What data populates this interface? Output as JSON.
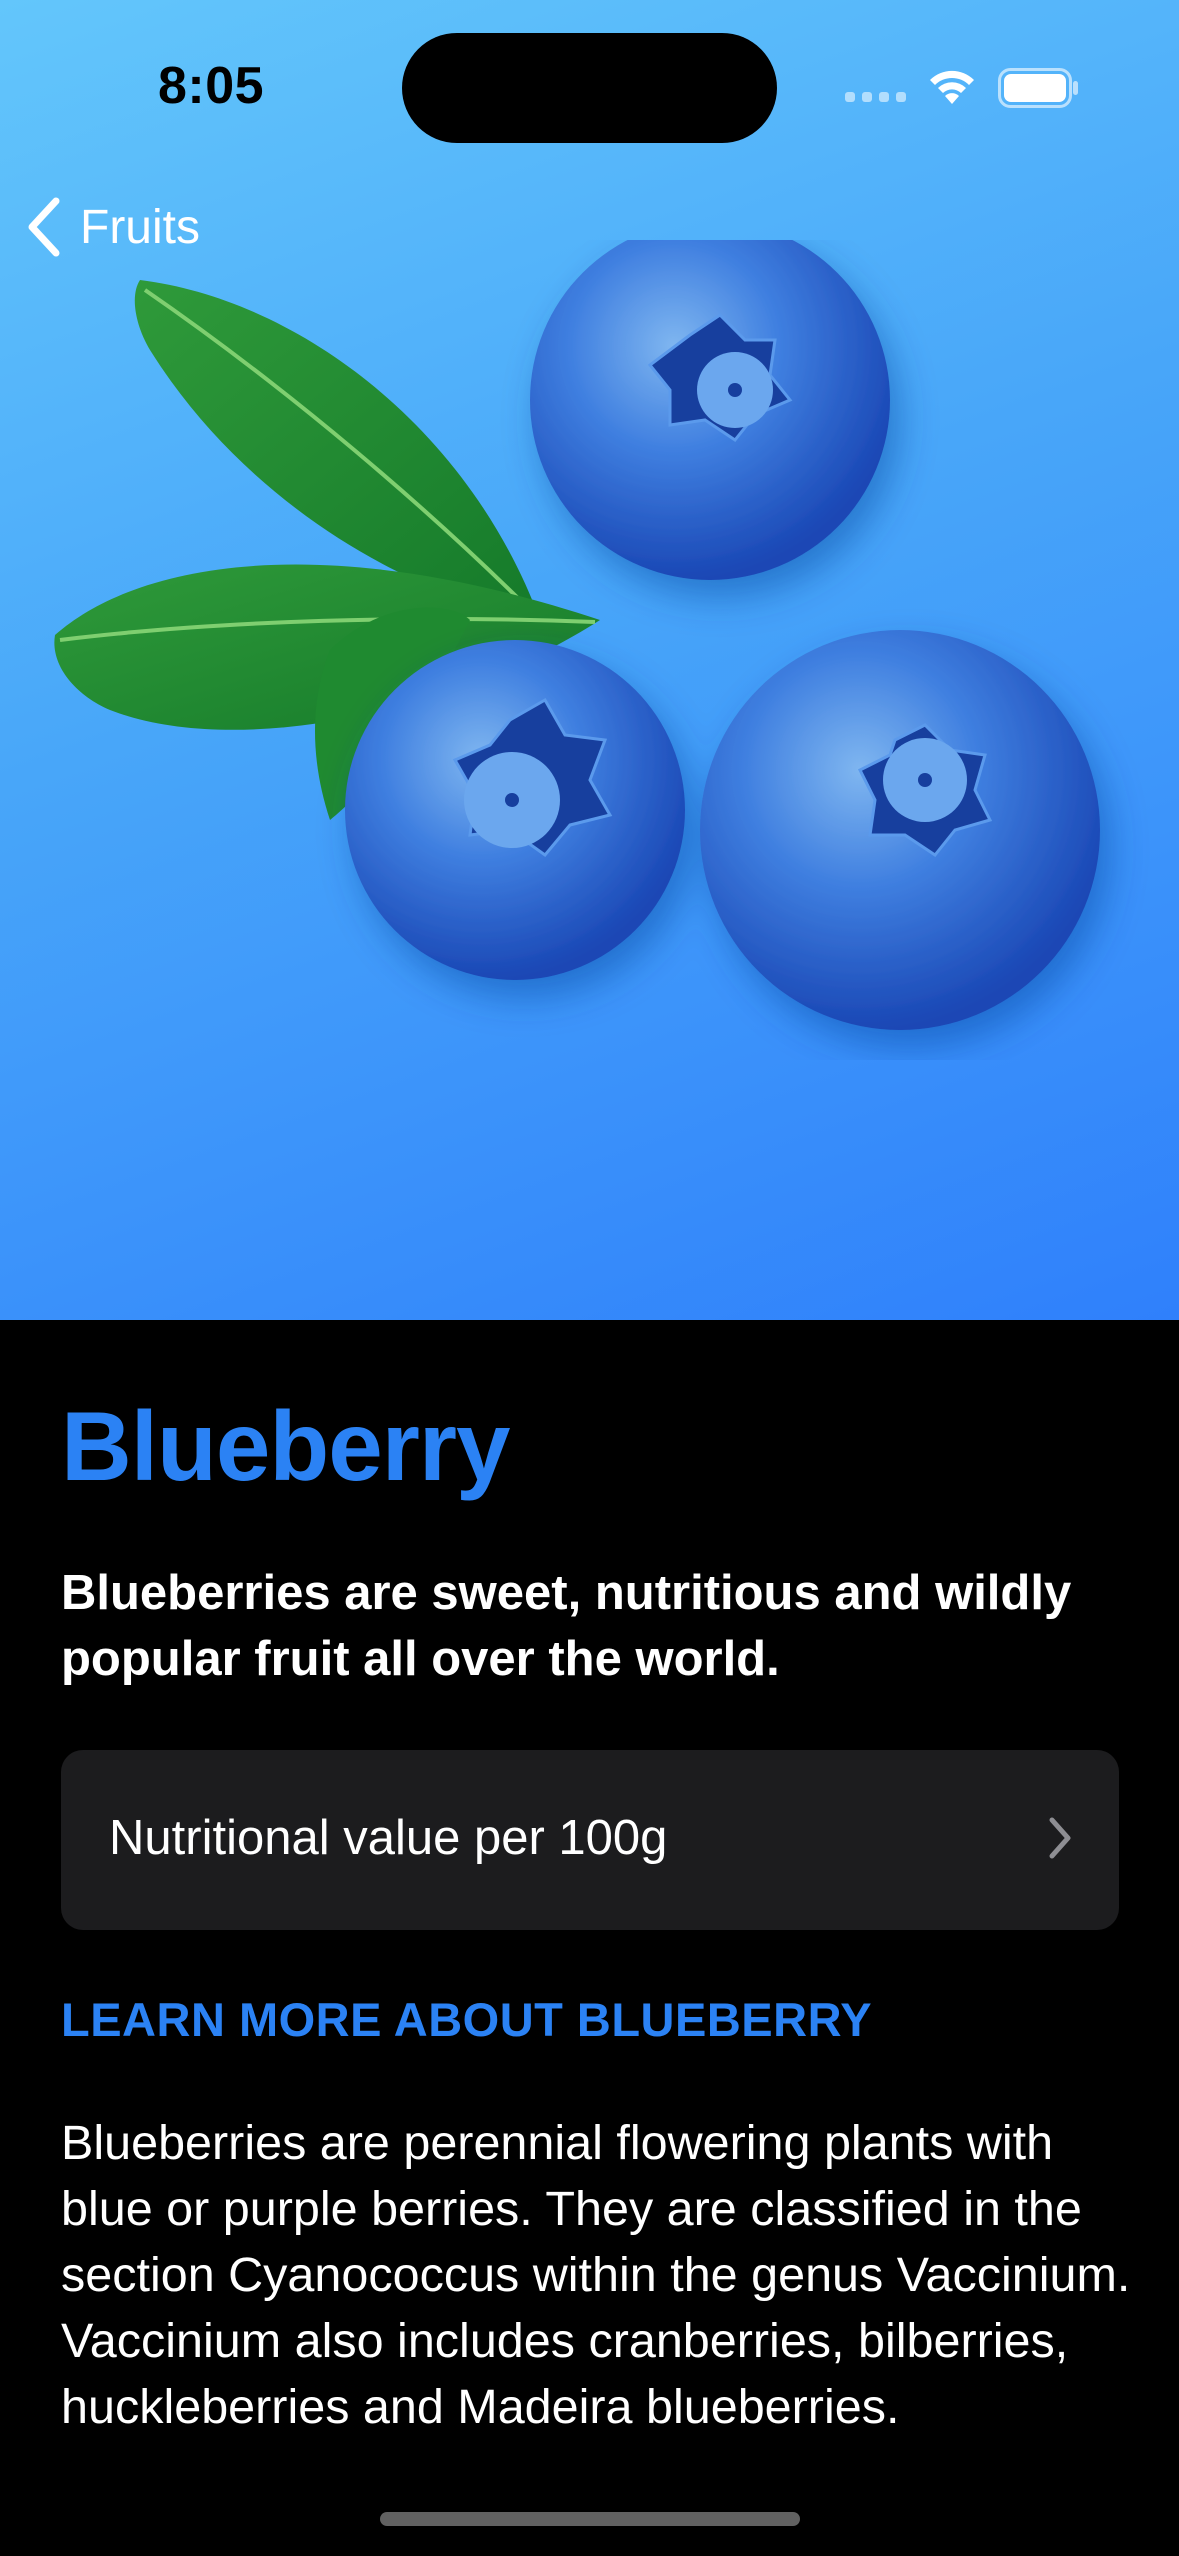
{
  "status_bar": {
    "time": "8:05"
  },
  "nav": {
    "back_label": "Fruits"
  },
  "fruit": {
    "title": "Blueberry",
    "headline": "Blueberries are sweet, nutritious and wildly popular fruit all over the world.",
    "nutrition_label": "Nutritional value per 100g",
    "learn_more": "LEARN MORE ABOUT BLUEBERRY",
    "description": "Blueberries are perennial flowering plants with blue or purple berries. They are classified in the section Cyanococcus within the genus Vaccinium. Vaccinium also includes cranberries, bilberries, huckleberries and Madeira blueberries."
  },
  "colors": {
    "accent": "#2b82f4",
    "hero_gradient_start": "#63c6fb",
    "hero_gradient_end": "#2f80fb",
    "card_background": "#1c1c1e"
  },
  "icons": {
    "back": "chevron-left-icon",
    "disclosure": "chevron-right-icon",
    "wifi": "wifi-icon",
    "battery": "battery-icon",
    "signal": "cellular-signal-icon"
  }
}
